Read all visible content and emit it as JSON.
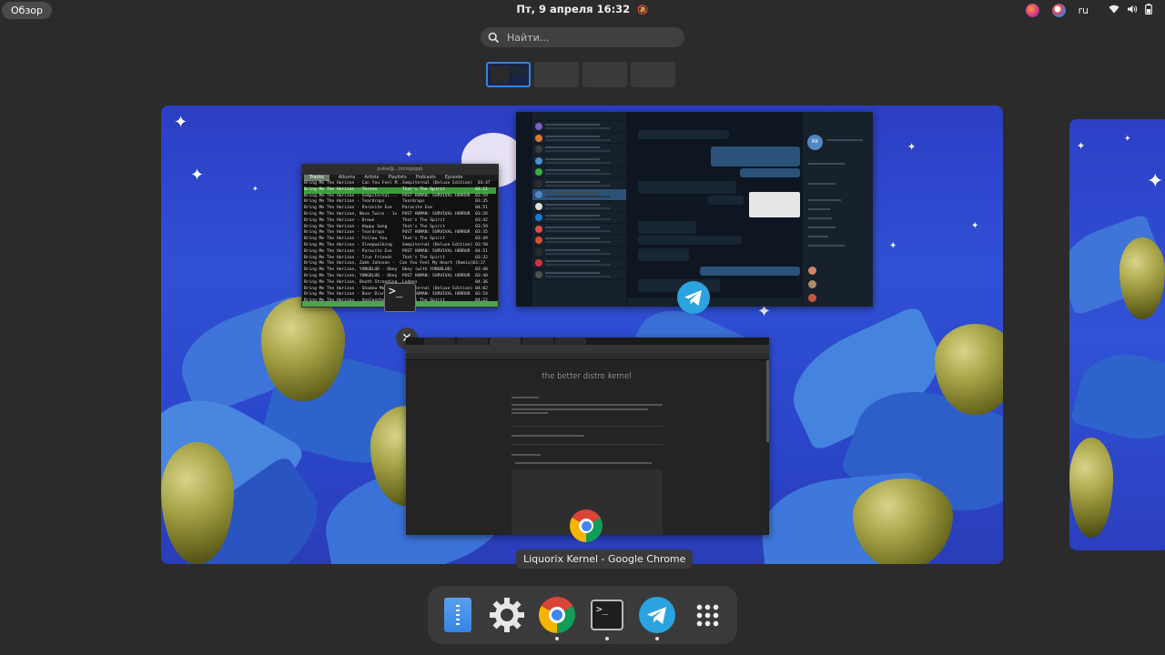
{
  "topbar": {
    "activities_label": "Обзор",
    "clock": "Пт, 9 апреля  16:32",
    "language": "ru",
    "tray_icons": [
      "firefox-icon",
      "vpn-icon",
      "wifi-icon",
      "volume-icon",
      "battery-icon"
    ]
  },
  "search": {
    "placeholder": "Найти..."
  },
  "workspaces": {
    "count": 4,
    "active_index": 0
  },
  "windows": {
    "terminal": {
      "title": "pulse@...(ncmpcpp)",
      "tabs": [
        "Tracks",
        "Albums",
        "Artists",
        "Playlists",
        "Podcasts",
        "Episode"
      ],
      "rows": [
        "Bring Me The Horizon - Can You Feel M..Sempiternal (Deluxe Edition)  03:47",
        "Bring Me The Horizon - Throne          That's The Spirit            03:11",
        "Bring Me The Horizon - Sempiternal...  POST HUMAN: SURVIVAL HORROR  03:59",
        "Bring Me The Horizon - Teardrops       Teardrops                    03:35",
        "Bring Me The Horizon - Parasite Eve    Parasite Eve                 04:51",
        "Bring Me The Horizon, Nova Twins - 1x  POST HUMAN: SURVIVAL HORROR  03:26",
        "Bring Me The Horizon - Drown           That's The Spirit            03:42",
        "Bring Me The Horizon - Happy Song      That's The Spirit            03:59",
        "Bring Me The Horizon - Teardrops       POST HUMAN: SURVIVAL HORROR  03:35",
        "Bring Me The Horizon - Follow You      That's The Spirit            03:49",
        "Bring Me The Horizon - Sleepwalking    Sempiternal (Deluxe Edition) 03:50",
        "Bring Me The Horizon - Parasite Eve    POST HUMAN: SURVIVAL HORROR  04:51",
        "Bring Me The Horizon - True Friends    That's The Spirit            03:32",
        "Bring Me The Horizon, Zakk Johnson -  Can You Feel My Heart (Remix)03:17",
        "Bring Me The Horizon, YUNGBLUD - Obey  Obey (with YUNGBLUD)         03:40",
        "Bring Me The Horizon, YUNGBLUD - Obey  POST HUMAN: SURVIVAL HORROR  03:40",
        "Bring Me The Horizon, Death Stranding..Ludens                       04:36",
        "Bring Me The Horizon - Shadow Moses    Sempiternal (Deluxe Edition) 04:02",
        "Bring Me The Horizon - Dear Diary,     POST HUMAN: SURVIVAL HORROR  02:54",
        "Bring Me The Horizon - Avalanche       That's The Spirit            04:22"
      ]
    },
    "chrome": {
      "page_title": "the better distro kernel",
      "label": "Liquorix Kernel - Google Chrome"
    }
  },
  "dash": {
    "apps": [
      {
        "name": "files",
        "running": false
      },
      {
        "name": "settings",
        "running": false
      },
      {
        "name": "chrome",
        "running": true
      },
      {
        "name": "terminal",
        "running": true
      },
      {
        "name": "telegram",
        "running": true
      },
      {
        "name": "show-apps",
        "running": false
      }
    ]
  },
  "colors": {
    "accent": "#3584e4",
    "panel": "#2b2b2b",
    "wallpaper": "#2f4bd1"
  }
}
